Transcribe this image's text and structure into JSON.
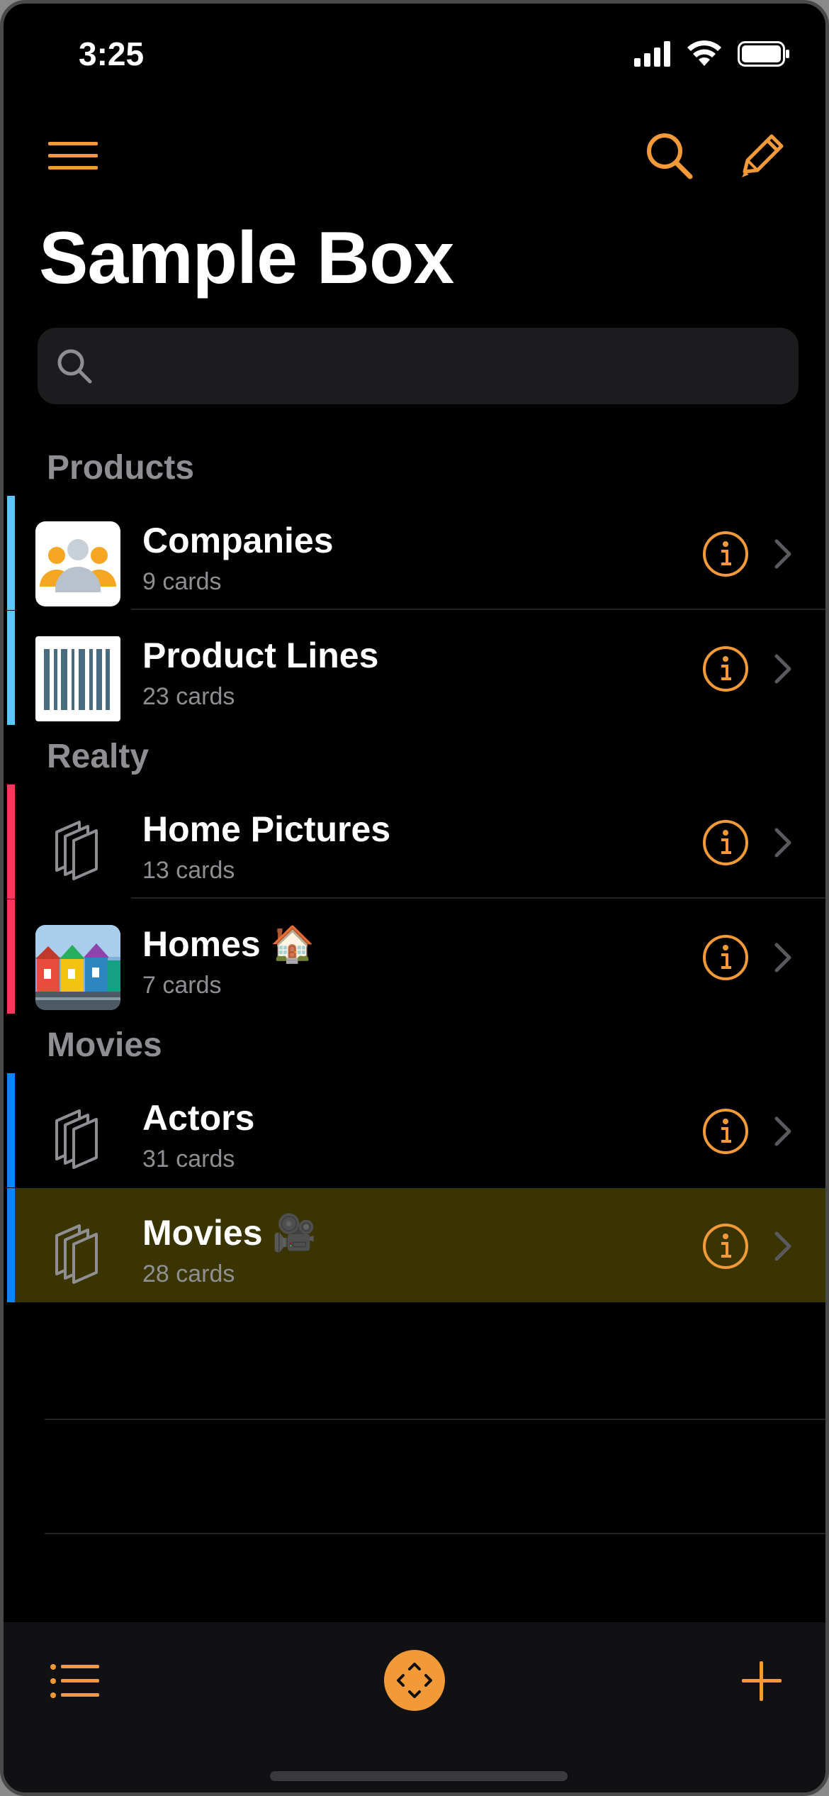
{
  "status": {
    "time": "3:25"
  },
  "app": {
    "title": "Sample Box",
    "accent": "#F29A38",
    "search_placeholder": ""
  },
  "sections": [
    {
      "header": "Products",
      "color": "#5AC8FA",
      "items": [
        {
          "title": "Companies",
          "subtitle": "9 cards",
          "thumb": "people-thumbnail"
        },
        {
          "title": "Product Lines",
          "subtitle": "23 cards",
          "thumb": "barcode-thumbnail"
        }
      ]
    },
    {
      "header": "Realty",
      "color": "#FF375F",
      "items": [
        {
          "title": "Home Pictures",
          "subtitle": "13 cards",
          "thumb": "card-stack-icon"
        },
        {
          "title": "Homes 🏠",
          "subtitle": "7 cards",
          "thumb": "colorful-houses-photo"
        }
      ]
    },
    {
      "header": "Movies",
      "color": "#0A84FF",
      "items": [
        {
          "title": "Actors",
          "subtitle": "31 cards",
          "thumb": "card-stack-icon"
        },
        {
          "title": "Movies 🎥",
          "subtitle": "28 cards",
          "thumb": "card-stack-icon",
          "selected": true,
          "highlight": "#3A3500"
        }
      ]
    }
  ],
  "icons": {
    "menu": "hamburger-icon",
    "search": "search-icon",
    "edit": "pencil-icon",
    "info": "info-circle-icon",
    "chevron": "chevron-right-icon",
    "list": "list-icon",
    "center": "expand-arrows-icon",
    "add": "plus-icon"
  }
}
